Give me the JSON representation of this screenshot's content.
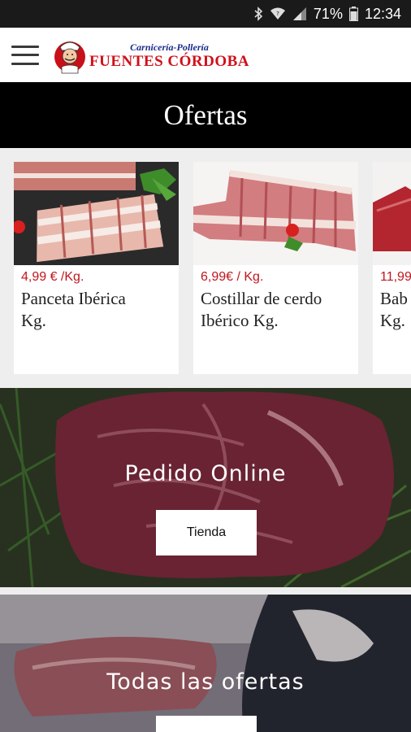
{
  "status_bar": {
    "battery": "71%",
    "time": "12:34",
    "icons": [
      "bluetooth-icon",
      "wifi-icon",
      "signal-icon",
      "battery-icon"
    ]
  },
  "header": {
    "logo_line1": "Carnicería-Pollería",
    "logo_line2": "FUENTES CÓRDOBA",
    "menu_icon": "hamburger-menu-icon"
  },
  "section_title": "Ofertas",
  "offers": [
    {
      "price": "4,99 € /Kg.",
      "name_line1": "Panceta Ibérica",
      "name_line2": "Kg."
    },
    {
      "price": "6,99€ / Kg.",
      "name_line1": "Costillar de cerdo",
      "name_line2": "Ibérico Kg."
    },
    {
      "price": "11,99",
      "name_line1": "Bab",
      "name_line2": "Kg."
    }
  ],
  "banners": [
    {
      "title": "Pedido Online",
      "button": "Tienda"
    },
    {
      "title": "Todas las ofertas"
    }
  ],
  "colors": {
    "price_red": "#c0171e",
    "brand_blue": "#1b2a8a",
    "brand_red": "#d0101a",
    "title_bar": "#000000"
  }
}
